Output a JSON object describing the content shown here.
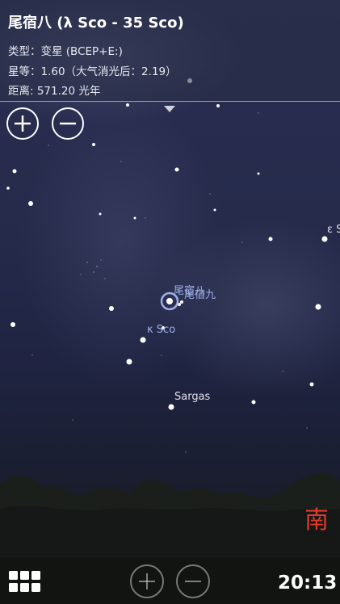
{
  "object_info": {
    "title": "尾宿八 (λ Sco - 35 Sco)",
    "type_line": "类型：变星 (BCEP+E:)",
    "magnitude_line": "星等：1.60（大气消光后：2.19）",
    "distance_line": "距离: 571.20 光年"
  },
  "star_labels": {
    "selected_primary": "尾宿八",
    "selected_secondary": "尾宿九",
    "kappa": "κ Sco",
    "sargas": "Sargas",
    "epsilon": "ε S"
  },
  "compass": {
    "direction": "南"
  },
  "clock": {
    "time": "20:13"
  },
  "icons": {
    "zoom_in": "plus-icon",
    "zoom_out": "minus-icon",
    "menu": "grid-menu-icon",
    "expand": "triangle-down-icon",
    "selection": "target-reticle-icon"
  },
  "colors": {
    "star_label": "#9fb0e6",
    "compass": "#e03a2a",
    "text": "#ffffff"
  }
}
